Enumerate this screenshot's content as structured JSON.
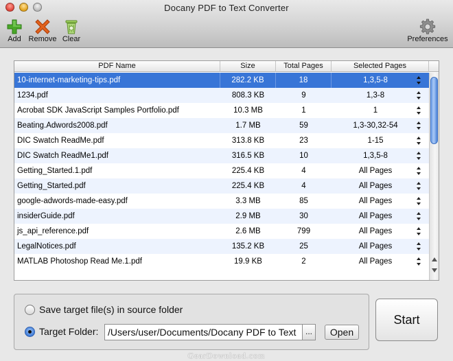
{
  "window": {
    "title": "Docany PDF to Text Converter"
  },
  "toolbar": {
    "add_label": "Add",
    "remove_label": "Remove",
    "clear_label": "Clear",
    "preferences_label": "Preferences",
    "icons": {
      "add": "plus-icon",
      "remove": "x-icon",
      "clear": "trash-icon",
      "preferences": "gear-icon"
    },
    "colors": {
      "add": "#4aa829",
      "remove": "#e2621c",
      "clear": "#8bbf4a"
    }
  },
  "table": {
    "columns": [
      "PDF Name",
      "Size",
      "Total Pages",
      "Selected Pages"
    ],
    "rows": [
      {
        "name": "10-internet-marketing-tips.pdf",
        "size": "282.2 KB",
        "pages": "18",
        "selected": "1,3,5-8"
      },
      {
        "name": "1234.pdf",
        "size": "808.3 KB",
        "pages": "9",
        "selected": "1,3-8"
      },
      {
        "name": "Acrobat SDK JavaScript Samples Portfolio.pdf",
        "size": "10.3 MB",
        "pages": "1",
        "selected": "1"
      },
      {
        "name": "Beating.Adwords2008.pdf",
        "size": "1.7 MB",
        "pages": "59",
        "selected": "1,3-30,32-54"
      },
      {
        "name": "DIC Swatch ReadMe.pdf",
        "size": "313.8 KB",
        "pages": "23",
        "selected": "1-15"
      },
      {
        "name": "DIC Swatch ReadMe1.pdf",
        "size": "316.5 KB",
        "pages": "10",
        "selected": "1,3,5-8"
      },
      {
        "name": "Getting_Started.1.pdf",
        "size": "225.4 KB",
        "pages": "4",
        "selected": "All Pages"
      },
      {
        "name": "Getting_Started.pdf",
        "size": "225.4 KB",
        "pages": "4",
        "selected": "All Pages"
      },
      {
        "name": "google-adwords-made-easy.pdf",
        "size": "3.3 MB",
        "pages": "85",
        "selected": "All Pages"
      },
      {
        "name": "insiderGuide.pdf",
        "size": "2.9 MB",
        "pages": "30",
        "selected": "All Pages"
      },
      {
        "name": "js_api_reference.pdf",
        "size": "2.6 MB",
        "pages": "799",
        "selected": "All Pages"
      },
      {
        "name": "LegalNotices.pdf",
        "size": "135.2 KB",
        "pages": "25",
        "selected": "All Pages"
      },
      {
        "name": "MATLAB Photoshop Read Me.1.pdf",
        "size": "19.9 KB",
        "pages": "2",
        "selected": "All Pages"
      }
    ],
    "selected_row_color": "#3875d7",
    "alt_row_color": "#edf3fe"
  },
  "output": {
    "save_in_source_label": "Save target file(s) in source folder",
    "target_folder_label": "Target Folder:",
    "target_folder_value": "/Users/user/Documents/Docany PDF to Text",
    "browse_label": "...",
    "open_label": "Open",
    "selected_option": "target_folder"
  },
  "start_label": "Start",
  "watermark": "GearDownload.com"
}
